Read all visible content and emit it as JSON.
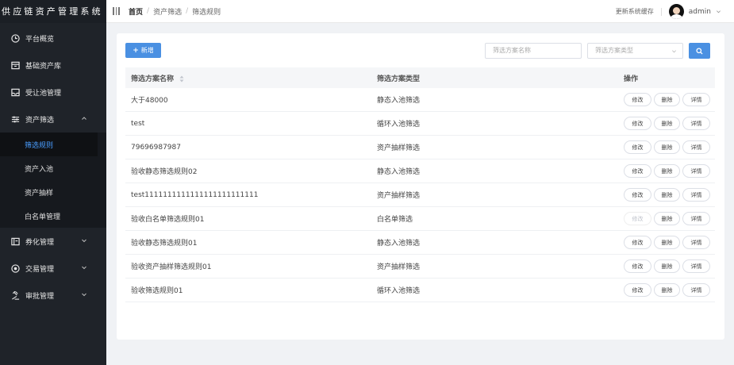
{
  "app": {
    "title": "供应链资产管理系统"
  },
  "sidebar": {
    "items": [
      {
        "label": "平台概览",
        "icon": "clock-icon"
      },
      {
        "label": "基础资产库",
        "icon": "archive-icon"
      },
      {
        "label": "受让池管理",
        "icon": "inbox-icon"
      },
      {
        "label": "资产筛选",
        "icon": "sliders-icon",
        "expanded": true
      },
      {
        "label": "券化管理",
        "icon": "ticket-icon"
      },
      {
        "label": "交易管理",
        "icon": "exchange-icon"
      },
      {
        "label": "审批管理",
        "icon": "gavel-icon"
      }
    ],
    "submenu": [
      {
        "label": "筛选规则",
        "active": true
      },
      {
        "label": "资产入池"
      },
      {
        "label": "资产抽样"
      },
      {
        "label": "白名单管理"
      }
    ]
  },
  "header": {
    "breadcrumb": [
      "首页",
      "资产筛选",
      "筛选规则"
    ],
    "cache_link": "更新系统缓存",
    "user": "admin"
  },
  "toolbar": {
    "add_label": "新增",
    "search_name_placeholder": "筛选方案名称",
    "search_type_placeholder": "筛选方案类型"
  },
  "table": {
    "columns": [
      "筛选方案名称",
      "筛选方案类型",
      "操作"
    ],
    "actions": {
      "edit": "修改",
      "delete": "删除",
      "detail": "详情"
    },
    "rows": [
      {
        "name": "大于48000",
        "type": "静态入池筛选",
        "edit_disabled": false
      },
      {
        "name": "test",
        "type": "循环入池筛选",
        "edit_disabled": false
      },
      {
        "name": "79696987987",
        "type": "资产抽样筛选",
        "edit_disabled": false
      },
      {
        "name": "验收静态筛选规则02",
        "type": "静态入池筛选",
        "edit_disabled": false
      },
      {
        "name": "test1111111111111111111111111",
        "type": "资产抽样筛选",
        "edit_disabled": false
      },
      {
        "name": "验收白名单筛选规则01",
        "type": "白名单筛选",
        "edit_disabled": true
      },
      {
        "name": "验收静态筛选规则01",
        "type": "静态入池筛选",
        "edit_disabled": false
      },
      {
        "name": "验收资产抽样筛选规则01",
        "type": "资产抽样筛选",
        "edit_disabled": false
      },
      {
        "name": "验收筛选规则01",
        "type": "循环入池筛选",
        "edit_disabled": false
      }
    ]
  },
  "colors": {
    "sidebar_bg": "#1f2329",
    "accent": "#4a90e2",
    "active_menu": "#4a9eff"
  }
}
